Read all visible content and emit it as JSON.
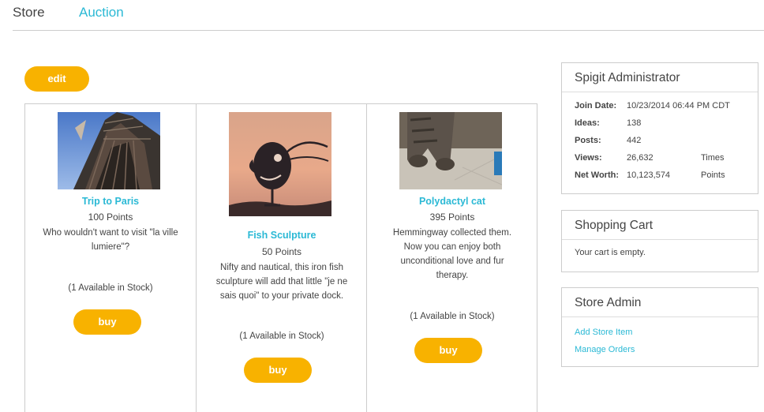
{
  "tabs": [
    {
      "label": "Store"
    },
    {
      "label": "Auction"
    }
  ],
  "edit_label": "edit",
  "items": [
    {
      "title": "Trip to Paris",
      "points": "100 Points",
      "desc_lines": [
        "Who wouldn't want to visit \"la ville",
        "lumiere\"?"
      ],
      "stock": "(1 Available in Stock)",
      "buy_label": "buy"
    },
    {
      "title": "Fish Sculpture",
      "points": "50 Points",
      "desc_lines": [
        "Nifty and nautical, this iron fish",
        "sculpture will add that little \"je ne",
        "sais quoi\" to your private dock."
      ],
      "stock": "(1 Available in Stock)",
      "buy_label": "buy"
    },
    {
      "title": "Polydactyl cat",
      "points": "395 Points",
      "desc_lines": [
        "Hemmingway collected them.",
        "Now you can enjoy both",
        "unconditional love and fur",
        "therapy."
      ],
      "stock": "(1 Available in Stock)",
      "buy_label": "buy"
    }
  ],
  "profile": {
    "title": "Spigit Administrator",
    "rows": [
      {
        "key": "Join Date:",
        "value": "10/23/2014 06:44 PM CDT",
        "unit": ""
      },
      {
        "key": "Ideas:",
        "value": "138",
        "unit": ""
      },
      {
        "key": "Posts:",
        "value": "442",
        "unit": ""
      },
      {
        "key": "Views:",
        "value": "26,632",
        "unit": "Times"
      },
      {
        "key": "Net Worth:",
        "value": "10,123,574",
        "unit": "Points"
      }
    ]
  },
  "cart": {
    "title": "Shopping Cart",
    "empty_text": "Your cart is empty."
  },
  "admin": {
    "title": "Store Admin",
    "links": [
      "Add Store Item",
      "Manage Orders"
    ]
  }
}
